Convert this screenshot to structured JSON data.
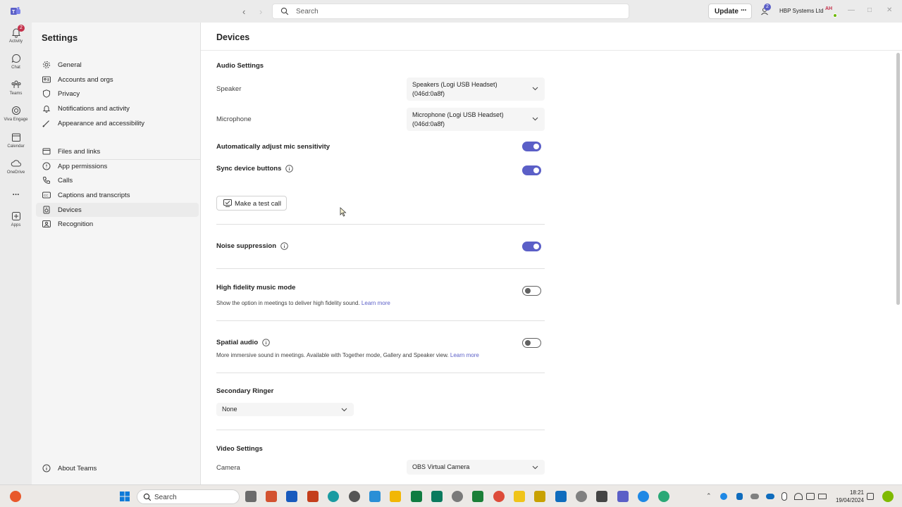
{
  "titlebar": {
    "search_placeholder": "Search",
    "update_label": "Update",
    "notifications_count": "2",
    "org_name": "HBP Systems Ltd",
    "avatar_initials": "AH"
  },
  "rail": {
    "items": [
      {
        "label": "Activity",
        "icon": "bell-icon",
        "badge": "2"
      },
      {
        "label": "Chat",
        "icon": "chat-icon"
      },
      {
        "label": "Teams",
        "icon": "teams-icon"
      },
      {
        "label": "Viva Engage",
        "icon": "viva-engage-icon"
      },
      {
        "label": "Calendar",
        "icon": "calendar-icon"
      },
      {
        "label": "OneDrive",
        "icon": "cloud-icon"
      },
      {
        "label": "...",
        "icon": "more-icon"
      },
      {
        "label": "Apps",
        "icon": "apps-icon"
      }
    ]
  },
  "settings": {
    "title": "Settings",
    "menu": [
      {
        "label": "General",
        "icon": "gear-icon"
      },
      {
        "label": "Accounts and orgs",
        "icon": "accounts-icon"
      },
      {
        "label": "Privacy",
        "icon": "shield-icon"
      },
      {
        "label": "Notifications and activity",
        "icon": "bell-icon"
      },
      {
        "label": "Appearance and accessibility",
        "icon": "paintbrush-icon"
      },
      {
        "label": "Files and links",
        "icon": "file-icon"
      },
      {
        "label": "App permissions",
        "icon": "shield-check-icon"
      },
      {
        "label": "Calls",
        "icon": "phone-icon"
      },
      {
        "label": "Captions and transcripts",
        "icon": "captions-icon"
      },
      {
        "label": "Devices",
        "icon": "speaker-icon",
        "selected": true
      },
      {
        "label": "Recognition",
        "icon": "recognition-icon"
      }
    ],
    "about_label": "About Teams"
  },
  "devices": {
    "title": "Devices",
    "audio_settings_title": "Audio Settings",
    "speaker_label": "Speaker",
    "speaker_value": "Speakers (Logi USB Headset) (046d:0a8f)",
    "microphone_label": "Microphone",
    "microphone_value": "Microphone (Logi USB Headset) (046d:0a8f)",
    "auto_mic_label": "Automatically adjust mic sensitivity",
    "auto_mic_on": true,
    "sync_buttons_label": "Sync device buttons",
    "sync_buttons_on": true,
    "test_call_label": "Make a test call",
    "noise_label": "Noise suppression",
    "noise_on": true,
    "hifi_label": "High fidelity music mode",
    "hifi_desc": "Show the option in meetings to deliver high fidelity sound.",
    "hifi_link": "Learn more",
    "hifi_on": false,
    "spatial_label": "Spatial audio",
    "spatial_desc": "More immersive sound in meetings. Available with Together mode, Gallery and Speaker view.",
    "spatial_link": "Learn more",
    "spatial_on": false,
    "ringer_title": "Secondary Ringer",
    "ringer_value": "None",
    "video_settings_title": "Video Settings",
    "camera_label": "Camera",
    "camera_value": "OBS Virtual Camera"
  },
  "taskbar": {
    "search_placeholder": "Search",
    "time": "18:21",
    "date": "19/04/2024"
  },
  "colors": {
    "accent": "#5b5fc7",
    "rail_bg": "#ebebeb",
    "sidebar_bg": "#f5f5f5"
  }
}
